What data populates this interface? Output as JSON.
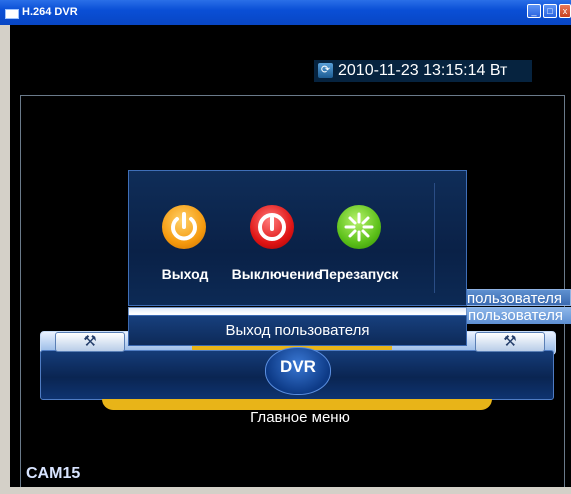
{
  "window": {
    "title": "H.264 DVR",
    "minimize_glyph": "_",
    "maximize_glyph": "□",
    "close_glyph": "x"
  },
  "datetime": {
    "icon": "refresh-icon",
    "text": "2010-11-23 13:15:14 Вт"
  },
  "logout_dialog": {
    "options": [
      {
        "label": "Выход",
        "icon": "power-icon",
        "color": "#f59a0e"
      },
      {
        "label": "Выключение",
        "icon": "power-off-icon",
        "color": "#e01515"
      },
      {
        "label": "Перезапуск",
        "icon": "restart-icon",
        "color": "#5cc01a"
      }
    ],
    "status": "Выход пользователя"
  },
  "submenu": {
    "items": [
      "Выход пользователя",
      "Смена пользователя"
    ]
  },
  "main_bar": {
    "logo": "DVR",
    "label": "Главное меню",
    "tool_icon": "tools-icon",
    "tool_glyph": "⚒"
  },
  "camera": {
    "label": "CAM15"
  },
  "colors": {
    "title_bar": "#0a4fd6",
    "accent_yellow": "#e8b418",
    "panel_blue": "#0a2147"
  }
}
